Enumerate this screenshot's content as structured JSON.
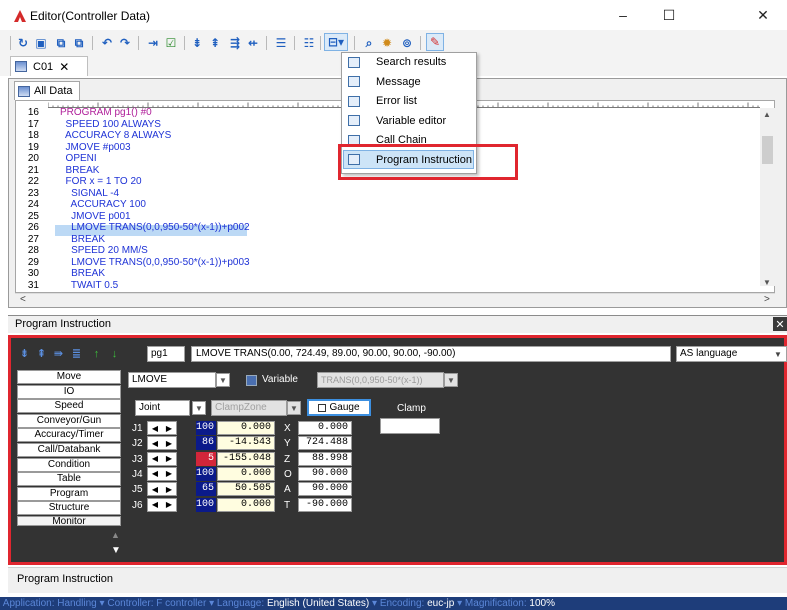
{
  "window": {
    "title": "Editor(Controller Data)",
    "minimize": "–",
    "maximize": "☐",
    "close": "✕"
  },
  "toolbar": {
    "icons": [
      "open-icon",
      "save-icon",
      "copy-icon",
      "paste-icon",
      "undo-icon",
      "redo-icon",
      "step-icon",
      "check-icon",
      "insert-line-icon",
      "delete-line-icon",
      "insert-point-icon",
      "delete-point-icon",
      "list-icon",
      "numbered-list-icon",
      "panel-menu-icon",
      "search-icon",
      "settings-icon",
      "monitor-icon",
      "pin-icon"
    ]
  },
  "doc_tab": {
    "label": "C01",
    "close": "✕"
  },
  "editor": {
    "tab_label": "All Data",
    "line_numbers": [
      "16",
      "17",
      "18",
      "19",
      "20",
      "21",
      "22",
      "23",
      "24",
      "25",
      "26",
      "27",
      "28",
      "29",
      "30",
      "31"
    ],
    "code_lines": [
      "PROGRAM pg1() #0",
      "  SPEED 100 ALWAYS",
      "  ACCURACY 8 ALWAYS",
      "  JMOVE #p003",
      "  OPENI",
      "  BREAK",
      "  FOR x = 1 TO 20",
      "    SIGNAL -4",
      "    ACCURACY 100",
      "    JMOVE p001",
      "    LMOVE TRANS(0,0,950-50*(x-1))+p002",
      "    BREAK",
      "    SPEED 20 MM/S",
      "    LMOVE TRANS(0,0,950-50*(x-1))+p003",
      "    BREAK",
      "    TWAIT 0.5"
    ],
    "highlighted_line": 10,
    "scroll_left": "<",
    "scroll_right": ">"
  },
  "menu": {
    "items": [
      "Search results",
      "Message",
      "Error list",
      "Variable editor",
      "Call Chain",
      "Program Instruction"
    ],
    "selected": "Program Instruction"
  },
  "program_instruction": {
    "title": "Program Instruction",
    "close": "✕",
    "step": "pg1",
    "instruction": "LMOVE TRANS(0.00, 724.49, 89.00, 90.00, 90.00, -90.00)",
    "language": "AS language",
    "categories": [
      "Move",
      "IO",
      "Speed",
      "Conveyor/Gun",
      "Accuracy/Timer",
      "Call/Databank",
      "Condition",
      "Table",
      "Program",
      "Structure",
      "Monitor"
    ],
    "move_type": "LMOVE",
    "variable_label": "Variable",
    "variable_value": "TRANS(0,0,950-50*(x-1))",
    "interpolation": "Joint",
    "clamp_zone": "ClampZone",
    "gauge_label": "Gauge",
    "clamp_label": "Clamp",
    "clamp_value": "",
    "joints": [
      {
        "label": "J1",
        "pct": "100",
        "pct_color": "#0b1a8a",
        "value": "0.000",
        "axis": "X",
        "axis_value": "0.000"
      },
      {
        "label": "J2",
        "pct": "86",
        "pct_color": "#0b1a8a",
        "value": "-14.543",
        "axis": "Y",
        "axis_value": "724.488"
      },
      {
        "label": "J3",
        "pct": "5",
        "pct_color": "#d3263a",
        "value": "-155.048",
        "axis": "Z",
        "axis_value": "88.998"
      },
      {
        "label": "J4",
        "pct": "100",
        "pct_color": "#0b1a8a",
        "value": "0.000",
        "axis": "O",
        "axis_value": "90.000"
      },
      {
        "label": "J5",
        "pct": "65",
        "pct_color": "#0b1a8a",
        "value": "50.505",
        "axis": "A",
        "axis_value": "90.000"
      },
      {
        "label": "J6",
        "pct": "100",
        "pct_color": "#0b1a8a",
        "value": "0.000",
        "axis": "T",
        "axis_value": "-90.000"
      }
    ],
    "status_label": "Program Instruction"
  },
  "statusbar": {
    "application_label": "Application:",
    "application_value": "Handling",
    "controller_label": "Controller:",
    "controller_value": "F controller",
    "language_label": "Language:",
    "language_value": "English (United States)",
    "encoding_label": "Encoding:",
    "encoding_value": "euc-jp",
    "magnification_label": "Magnification:",
    "magnification_value": "100%"
  },
  "colors": {
    "accent_red": "#e0262f",
    "panel_dark": "#333333",
    "code_blue": "#1f33d6",
    "keyword_magenta": "#b0209a",
    "status_bar": "#1e3d7a"
  }
}
